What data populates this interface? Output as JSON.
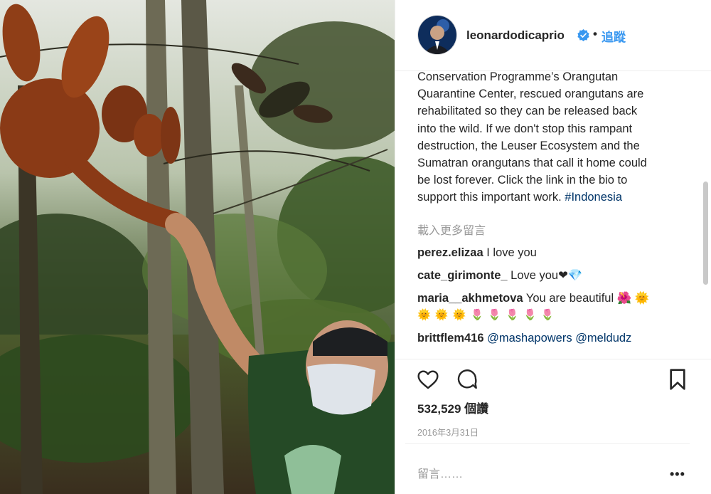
{
  "post": {
    "username": "leonardodicaprio",
    "separator": "•",
    "follow_label": "追蹤",
    "caption_lines": [
      "Conservation Programme’s Orangutan",
      "Quarantine Center, rescued orangutans are",
      "rehabilitated so they can be released back",
      "into the wild. If we don't stop this rampant",
      "destruction, the Leuser Ecosystem and the",
      "Sumatran orangutans that call it home could",
      "be lost forever. Click the link in the bio to",
      "support this important work."
    ],
    "caption_hashtag": "#Indonesia",
    "load_more_label": "載入更多留言",
    "comments": [
      {
        "user": "perez.elizaa",
        "text": "I love you"
      },
      {
        "user": "cate_girimonte_",
        "text": "Love you❤💎"
      },
      {
        "user": "maria__akhmetova",
        "text": "You are beautiful 🌺 🌞",
        "extra": "🌞 🌞 🌞 🌷 🌷 🌷 🌷 🌷"
      },
      {
        "user": "brittflem416",
        "mention1": "@mashapowers",
        "mention2": "@meldudz"
      }
    ],
    "views": "532,529 個讚",
    "date": "2016年3月31日",
    "add_comment_placeholder": "留言……",
    "more_label": "•••"
  },
  "icons": {
    "verified": "verified-badge-icon",
    "like": "heart-icon",
    "comment": "comment-bubble-icon",
    "save": "bookmark-icon",
    "more": "more-options-icon"
  },
  "colors": {
    "link": "#3897f0",
    "hashtag": "#003569",
    "muted": "#999999",
    "text": "#262626"
  }
}
